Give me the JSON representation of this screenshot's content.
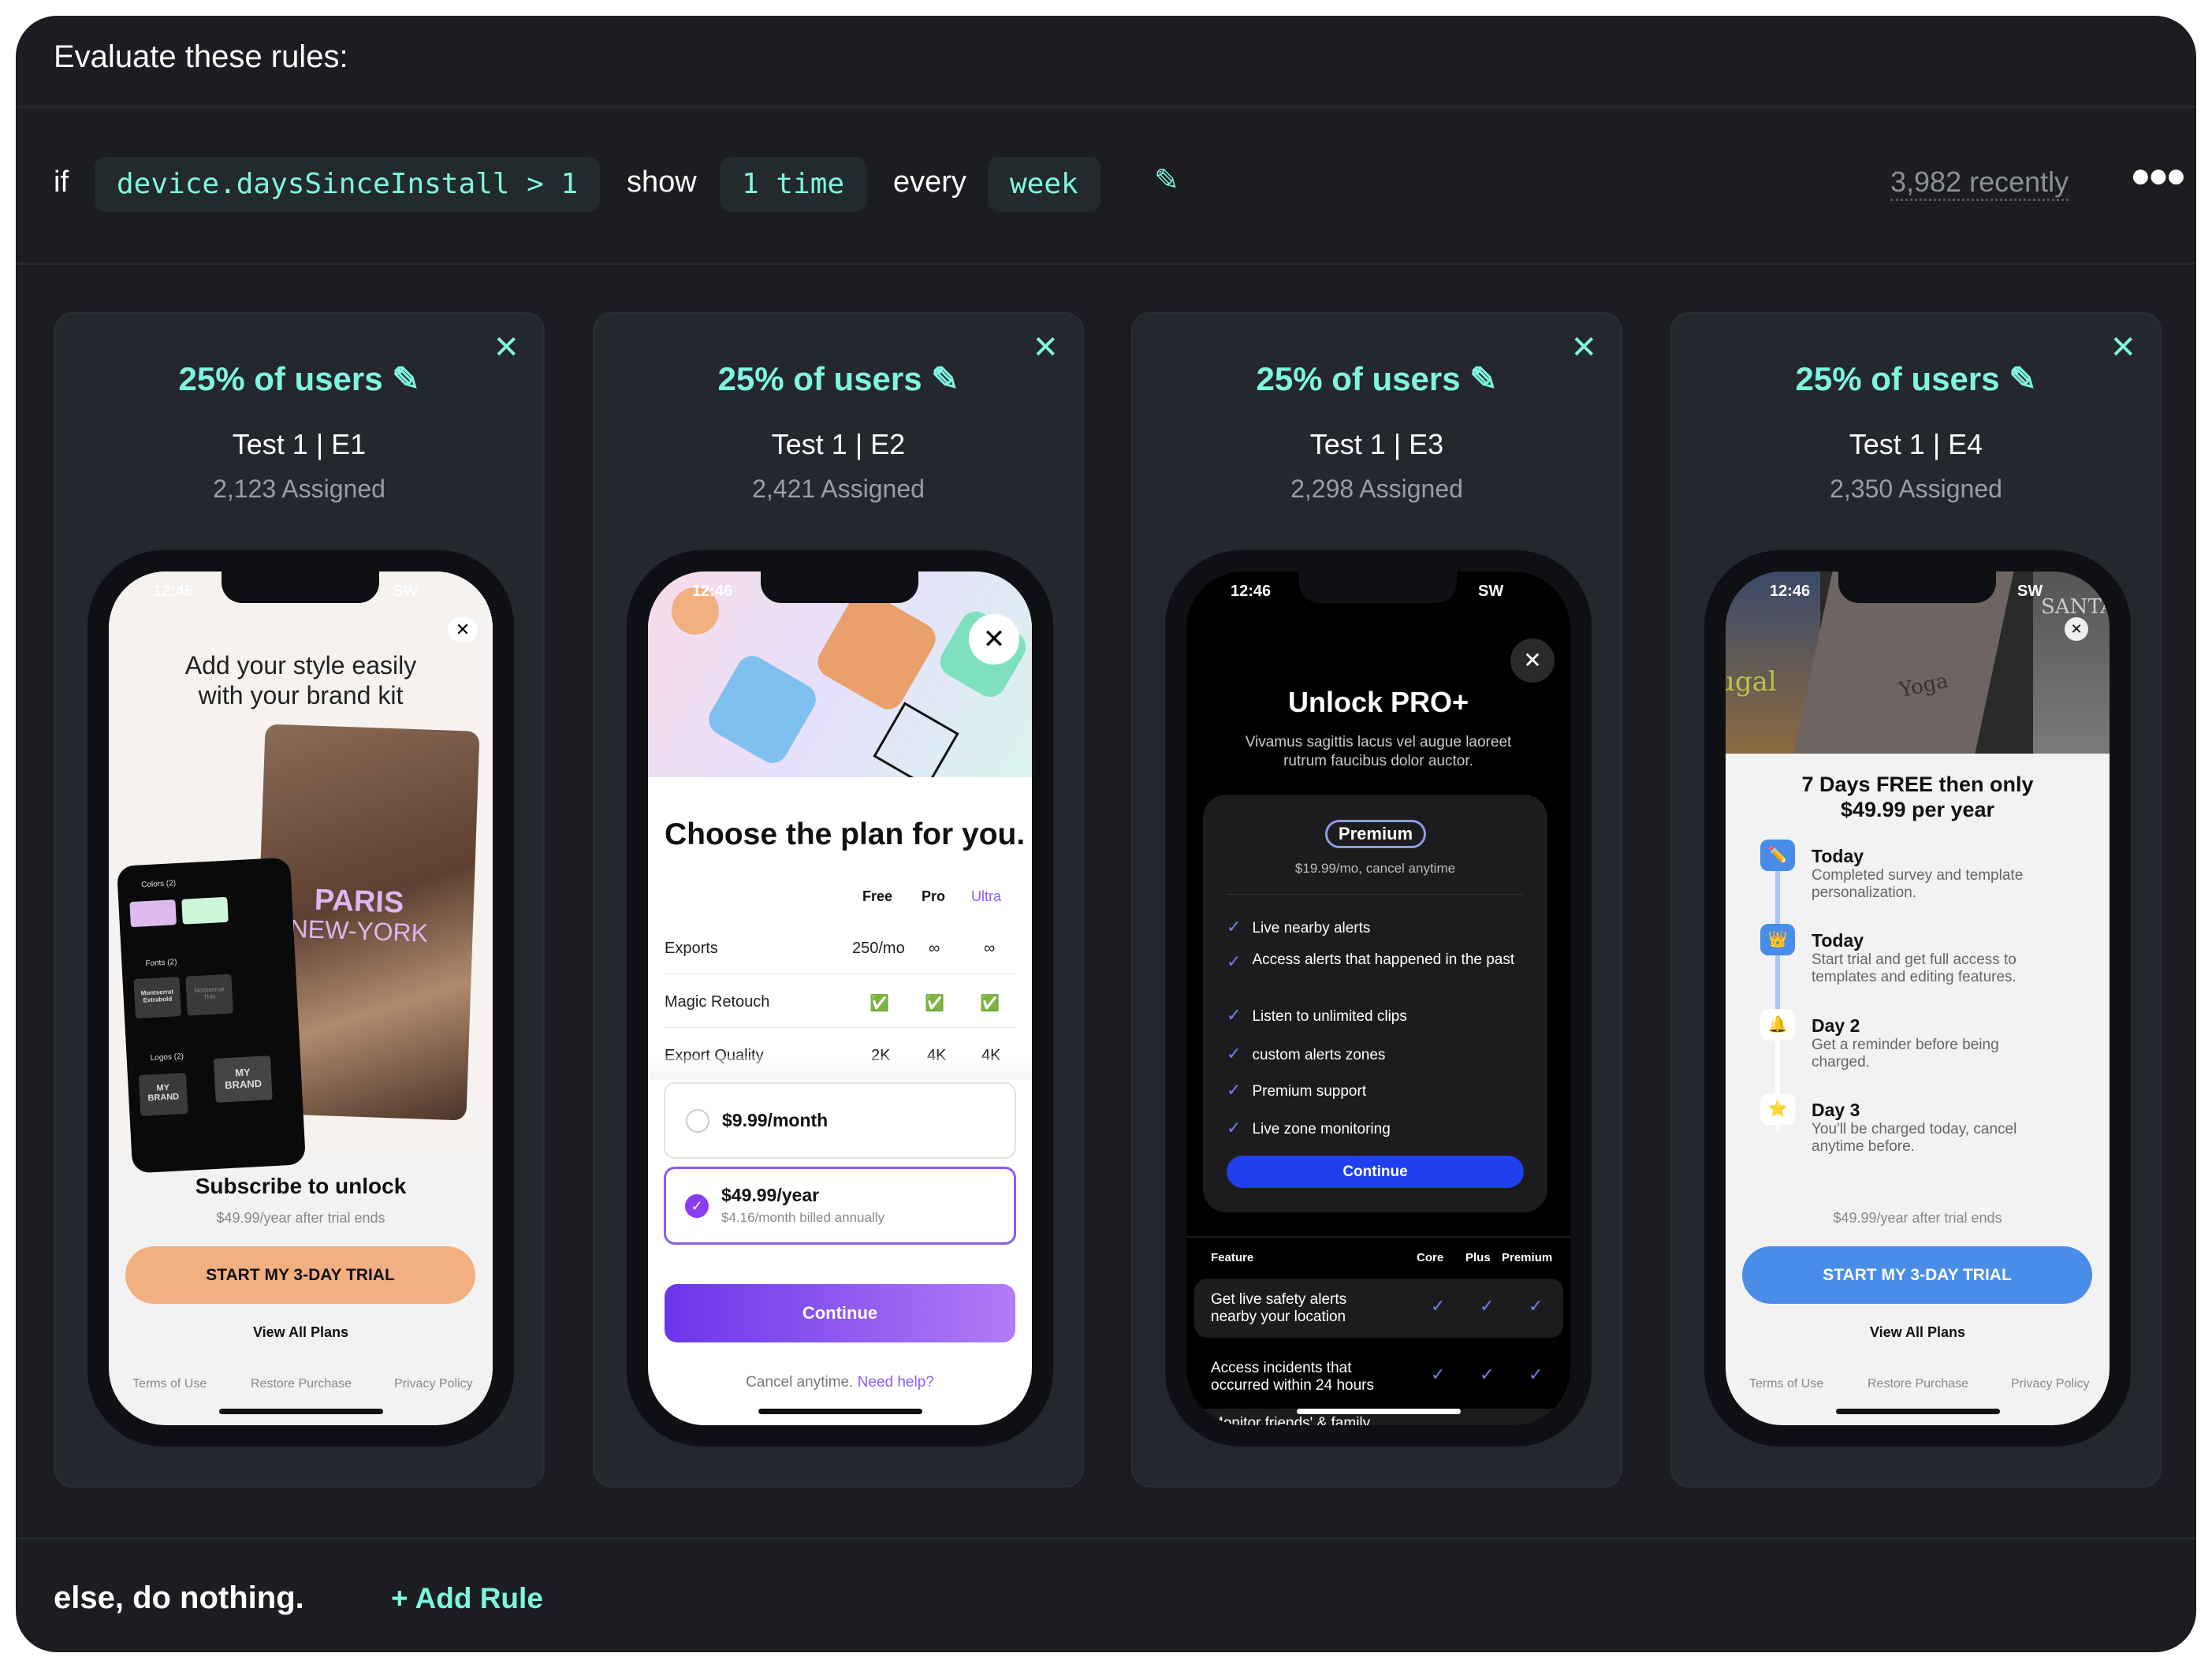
{
  "header": {
    "title": "Evaluate these rules:"
  },
  "rule": {
    "if": "if",
    "condition": "device.daysSinceInstall > 1",
    "show": "show",
    "frequency": "1 time",
    "every": "every",
    "period": "week",
    "edit_icon": "pencil-icon",
    "recent": "3,982 recently",
    "more_icon": "ellipsis-icon"
  },
  "colors": {
    "accent": "#7ff5e0",
    "panel": "#1b1d21",
    "card": "#24272e"
  },
  "cards": [
    {
      "percent": "25% of users",
      "name": "Test 1",
      "variant": "E1",
      "assigned": "2,123 Assigned"
    },
    {
      "percent": "25% of users",
      "name": "Test 1",
      "variant": "E2",
      "assigned": "2,421 Assigned"
    },
    {
      "percent": "25% of users",
      "name": "Test 1",
      "variant": "E3",
      "assigned": "2,298 Assigned"
    },
    {
      "percent": "25% of users",
      "name": "Test 1",
      "variant": "E4",
      "assigned": "2,350 Assigned"
    }
  ],
  "status": {
    "time": "12:46",
    "carrier": "SW"
  },
  "e1": {
    "title_l1": "Add your style easily",
    "title_l2": "with your brand kit",
    "photo_text1": "PARIS",
    "photo_text2": "NEW-YORK",
    "mock": {
      "colors": "Colors (2)",
      "fonts": "Fonts (2)",
      "logos": "Logos (2)",
      "font1": "Montserrat Extrabold",
      "font2": "Montserrat Thin",
      "logo": "MY BRAND"
    },
    "subscribe": "Subscribe to unlock",
    "price_note": "$49.99/year after trial ends",
    "cta": "START MY 3-DAY TRIAL",
    "view_all": "View All Plans",
    "terms": "Terms of Use",
    "restore": "Restore Purchase",
    "privacy": "Privacy Policy",
    "cta_color": "#f2b080"
  },
  "e2": {
    "title": "Choose the plan for you.",
    "columns": [
      "Free",
      "Pro",
      "Ultra"
    ],
    "rows": [
      {
        "label": "Exports",
        "values": [
          "250/mo",
          "∞",
          "∞"
        ]
      },
      {
        "label": "Magic Retouch",
        "values": [
          "✅",
          "✅",
          "✅"
        ]
      },
      {
        "label": "Export Quality",
        "values": [
          "2K",
          "4K",
          "4K"
        ]
      }
    ],
    "option1": "$9.99/month",
    "option2": "$49.99/year",
    "option2_sub": "$4.16/month billed annually",
    "selected": "option2",
    "continue": "Continue",
    "cancel": "Cancel anytime.",
    "help": "Need help?"
  },
  "e3": {
    "title": "Unlock PRO+",
    "subtitle_l1": "Vivamus sagittis lacus vel augue laoreet",
    "subtitle_l2": "rutrum faucibus dolor auctor.",
    "badge": "Premium",
    "price": "$19.99/mo, cancel anytime",
    "features": [
      "Live nearby alerts",
      "Access alerts that happened in the past",
      "Listen to unlimited clips",
      "custom alerts zones",
      "Premium support",
      "Live zone monitoring"
    ],
    "continue": "Continue",
    "table": {
      "headers": [
        "Feature",
        "Core",
        "Plus",
        "Premium"
      ],
      "rows": [
        {
          "l1": "Get live safety alerts",
          "l2": "nearby your location"
        },
        {
          "l1": "Access incidents that",
          "l2": "occurred within 24 hours"
        },
        {
          "l1": "Monitor friends' & family",
          "l2": ""
        }
      ]
    }
  },
  "e4": {
    "images": [
      "ugal",
      "Yoga",
      "SANTA"
    ],
    "title_l1": "7 Days FREE then only",
    "title_l2": "$49.99 per year",
    "timeline": [
      {
        "title": "Today",
        "desc": "Completed survey and template personalization.",
        "icon": "✏️"
      },
      {
        "title": "Today",
        "desc": "Start trial and get full access to templates and editing features.",
        "icon": "👑"
      },
      {
        "title": "Day 2",
        "desc": "Get a reminder before being charged.",
        "icon": "🔔"
      },
      {
        "title": "Day 3",
        "desc": "You'll be charged today, cancel anytime before.",
        "icon": "⭐"
      }
    ],
    "price_note": "$49.99/year after trial ends",
    "cta": "START MY 3-DAY TRIAL",
    "view_all": "View All Plans",
    "terms": "Terms of Use",
    "restore": "Restore Purchase",
    "privacy": "Privacy Policy",
    "cta_color": "#4a8de8"
  },
  "footer": {
    "else": "else, do nothing.",
    "add_rule": "+ Add Rule"
  }
}
